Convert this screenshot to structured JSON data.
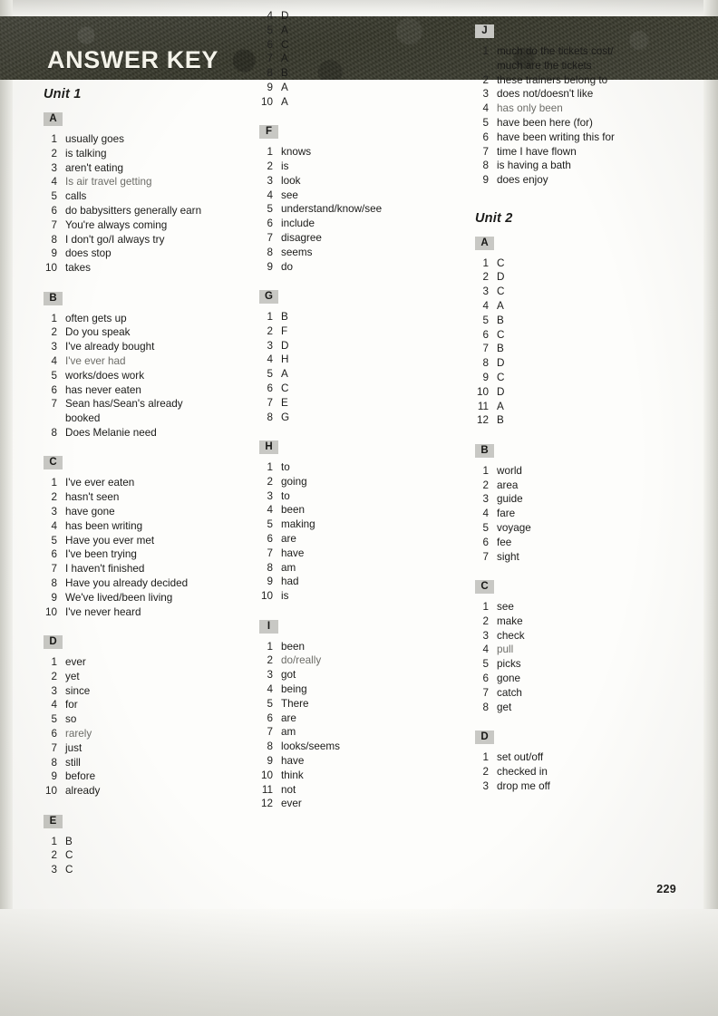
{
  "header": {
    "title": "ANSWER KEY",
    "band_color": "#37382c",
    "title_color": "#f4f3ea"
  },
  "page_number": "229",
  "columns": [
    {
      "name": "column-1",
      "blocks": [
        {
          "type": "unit",
          "label": "Unit 1"
        },
        {
          "type": "section",
          "letter": "A",
          "items": [
            {
              "n": "1",
              "text": "usually goes"
            },
            {
              "n": "2",
              "text": "is talking"
            },
            {
              "n": "3",
              "text": "aren't eating"
            },
            {
              "n": "4",
              "text": "Is air travel getting",
              "faded": true
            },
            {
              "n": "5",
              "text": "calls"
            },
            {
              "n": "6",
              "text": "do babysitters generally earn"
            },
            {
              "n": "7",
              "text": "You're always coming"
            },
            {
              "n": "8",
              "text": "I don't go/I always try"
            },
            {
              "n": "9",
              "text": "does stop"
            },
            {
              "n": "10",
              "text": "takes"
            }
          ]
        },
        {
          "type": "section",
          "letter": "B",
          "items": [
            {
              "n": "1",
              "text": "often gets up"
            },
            {
              "n": "2",
              "text": "Do you speak"
            },
            {
              "n": "3",
              "text": "I've already bought"
            },
            {
              "n": "4",
              "text": "I've ever had",
              "faded": true
            },
            {
              "n": "5",
              "text": "works/does work"
            },
            {
              "n": "6",
              "text": "has never eaten"
            },
            {
              "n": "7",
              "text": "Sean has/Sean's already"
            },
            {
              "n": "",
              "text": "booked"
            },
            {
              "n": "8",
              "text": "Does Melanie need"
            }
          ]
        },
        {
          "type": "section",
          "letter": "C",
          "items": [
            {
              "n": "1",
              "text": "I've ever eaten"
            },
            {
              "n": "2",
              "text": "hasn't seen"
            },
            {
              "n": "3",
              "text": "have gone"
            },
            {
              "n": "4",
              "text": "has been writing"
            },
            {
              "n": "5",
              "text": "Have you ever met"
            },
            {
              "n": "6",
              "text": "I've been trying"
            },
            {
              "n": "7",
              "text": "I haven't finished"
            },
            {
              "n": "8",
              "text": "Have you already decided"
            },
            {
              "n": "9",
              "text": "We've lived/been living"
            },
            {
              "n": "10",
              "text": "I've never heard"
            }
          ]
        },
        {
          "type": "section",
          "letter": "D",
          "items": [
            {
              "n": "1",
              "text": "ever"
            },
            {
              "n": "2",
              "text": "yet"
            },
            {
              "n": "3",
              "text": "since"
            },
            {
              "n": "4",
              "text": "for"
            },
            {
              "n": "5",
              "text": "so"
            },
            {
              "n": "6",
              "text": "rarely",
              "faded": true
            },
            {
              "n": "7",
              "text": "just"
            },
            {
              "n": "8",
              "text": "still"
            },
            {
              "n": "9",
              "text": "before"
            },
            {
              "n": "10",
              "text": "already"
            }
          ]
        },
        {
          "type": "section",
          "letter": "E",
          "items": [
            {
              "n": "1",
              "text": "B"
            },
            {
              "n": "2",
              "text": "C"
            },
            {
              "n": "3",
              "text": "C"
            }
          ]
        }
      ]
    },
    {
      "name": "column-2",
      "blocks": [
        {
          "type": "section",
          "letter": "",
          "continued": true,
          "items": [
            {
              "n": "4",
              "text": "D"
            },
            {
              "n": "5",
              "text": "A"
            },
            {
              "n": "6",
              "text": "C"
            },
            {
              "n": "7",
              "text": "A"
            },
            {
              "n": "8",
              "text": "B"
            },
            {
              "n": "9",
              "text": "A"
            },
            {
              "n": "10",
              "text": "A"
            }
          ]
        },
        {
          "type": "section",
          "letter": "F",
          "items": [
            {
              "n": "1",
              "text": "knows"
            },
            {
              "n": "2",
              "text": "is"
            },
            {
              "n": "3",
              "text": "look"
            },
            {
              "n": "4",
              "text": "see"
            },
            {
              "n": "5",
              "text": "understand/know/see"
            },
            {
              "n": "6",
              "text": "include"
            },
            {
              "n": "7",
              "text": "disagree"
            },
            {
              "n": "8",
              "text": "seems"
            },
            {
              "n": "9",
              "text": "do"
            }
          ]
        },
        {
          "type": "section",
          "letter": "G",
          "items": [
            {
              "n": "1",
              "text": "B"
            },
            {
              "n": "2",
              "text": "F"
            },
            {
              "n": "3",
              "text": "D"
            },
            {
              "n": "4",
              "text": "H"
            },
            {
              "n": "5",
              "text": "A"
            },
            {
              "n": "6",
              "text": "C"
            },
            {
              "n": "7",
              "text": "E"
            },
            {
              "n": "8",
              "text": "G"
            }
          ]
        },
        {
          "type": "section",
          "letter": "H",
          "items": [
            {
              "n": "1",
              "text": "to"
            },
            {
              "n": "2",
              "text": "going"
            },
            {
              "n": "3",
              "text": "to"
            },
            {
              "n": "4",
              "text": "been"
            },
            {
              "n": "5",
              "text": "making"
            },
            {
              "n": "6",
              "text": "are"
            },
            {
              "n": "7",
              "text": "have"
            },
            {
              "n": "8",
              "text": "am"
            },
            {
              "n": "9",
              "text": "had"
            },
            {
              "n": "10",
              "text": "is"
            }
          ]
        },
        {
          "type": "section",
          "letter": "I",
          "items": [
            {
              "n": "1",
              "text": "been"
            },
            {
              "n": "2",
              "text": "do/really",
              "faded": true
            },
            {
              "n": "3",
              "text": "got"
            },
            {
              "n": "4",
              "text": "being"
            },
            {
              "n": "5",
              "text": "There"
            },
            {
              "n": "6",
              "text": "are"
            },
            {
              "n": "7",
              "text": "am"
            },
            {
              "n": "8",
              "text": "looks/seems"
            },
            {
              "n": "9",
              "text": "have"
            },
            {
              "n": "10",
              "text": "think"
            },
            {
              "n": "11",
              "text": "not"
            },
            {
              "n": "12",
              "text": "ever"
            }
          ]
        }
      ]
    },
    {
      "name": "column-3",
      "blocks": [
        {
          "type": "section",
          "letter": "J",
          "items": [
            {
              "n": "1",
              "text": "much do the tickets cost/"
            },
            {
              "n": "",
              "text": "much are the tickets"
            },
            {
              "n": "2",
              "text": "these trainers belong to"
            },
            {
              "n": "3",
              "text": "does not/doesn't like"
            },
            {
              "n": "4",
              "text": "has only been",
              "faded": true
            },
            {
              "n": "5",
              "text": "have been here (for)"
            },
            {
              "n": "6",
              "text": "have been writing this for"
            },
            {
              "n": "7",
              "text": "time I have flown"
            },
            {
              "n": "8",
              "text": "is having a bath"
            },
            {
              "n": "9",
              "text": "does enjoy"
            }
          ]
        },
        {
          "type": "unit",
          "label": "Unit 2",
          "spaced": true
        },
        {
          "type": "section",
          "letter": "A",
          "items": [
            {
              "n": "1",
              "text": "C"
            },
            {
              "n": "2",
              "text": "D"
            },
            {
              "n": "3",
              "text": "C"
            },
            {
              "n": "4",
              "text": "A"
            },
            {
              "n": "5",
              "text": "B"
            },
            {
              "n": "6",
              "text": "C"
            },
            {
              "n": "7",
              "text": "B"
            },
            {
              "n": "8",
              "text": "D"
            },
            {
              "n": "9",
              "text": "C"
            },
            {
              "n": "10",
              "text": "D"
            },
            {
              "n": "11",
              "text": "A"
            },
            {
              "n": "12",
              "text": "B"
            }
          ]
        },
        {
          "type": "section",
          "letter": "B",
          "items": [
            {
              "n": "1",
              "text": "world"
            },
            {
              "n": "2",
              "text": "area"
            },
            {
              "n": "3",
              "text": "guide"
            },
            {
              "n": "4",
              "text": "fare"
            },
            {
              "n": "5",
              "text": "voyage"
            },
            {
              "n": "6",
              "text": "fee"
            },
            {
              "n": "7",
              "text": "sight"
            }
          ]
        },
        {
          "type": "section",
          "letter": "C",
          "items": [
            {
              "n": "1",
              "text": "see"
            },
            {
              "n": "2",
              "text": "make"
            },
            {
              "n": "3",
              "text": "check"
            },
            {
              "n": "4",
              "text": "pull",
              "faded": true
            },
            {
              "n": "5",
              "text": "picks"
            },
            {
              "n": "6",
              "text": "gone"
            },
            {
              "n": "7",
              "text": "catch"
            },
            {
              "n": "8",
              "text": "get"
            }
          ]
        },
        {
          "type": "section",
          "letter": "D",
          "items": [
            {
              "n": "1",
              "text": "set out/off"
            },
            {
              "n": "2",
              "text": "checked in"
            },
            {
              "n": "3",
              "text": "drop me off"
            }
          ]
        }
      ]
    }
  ]
}
